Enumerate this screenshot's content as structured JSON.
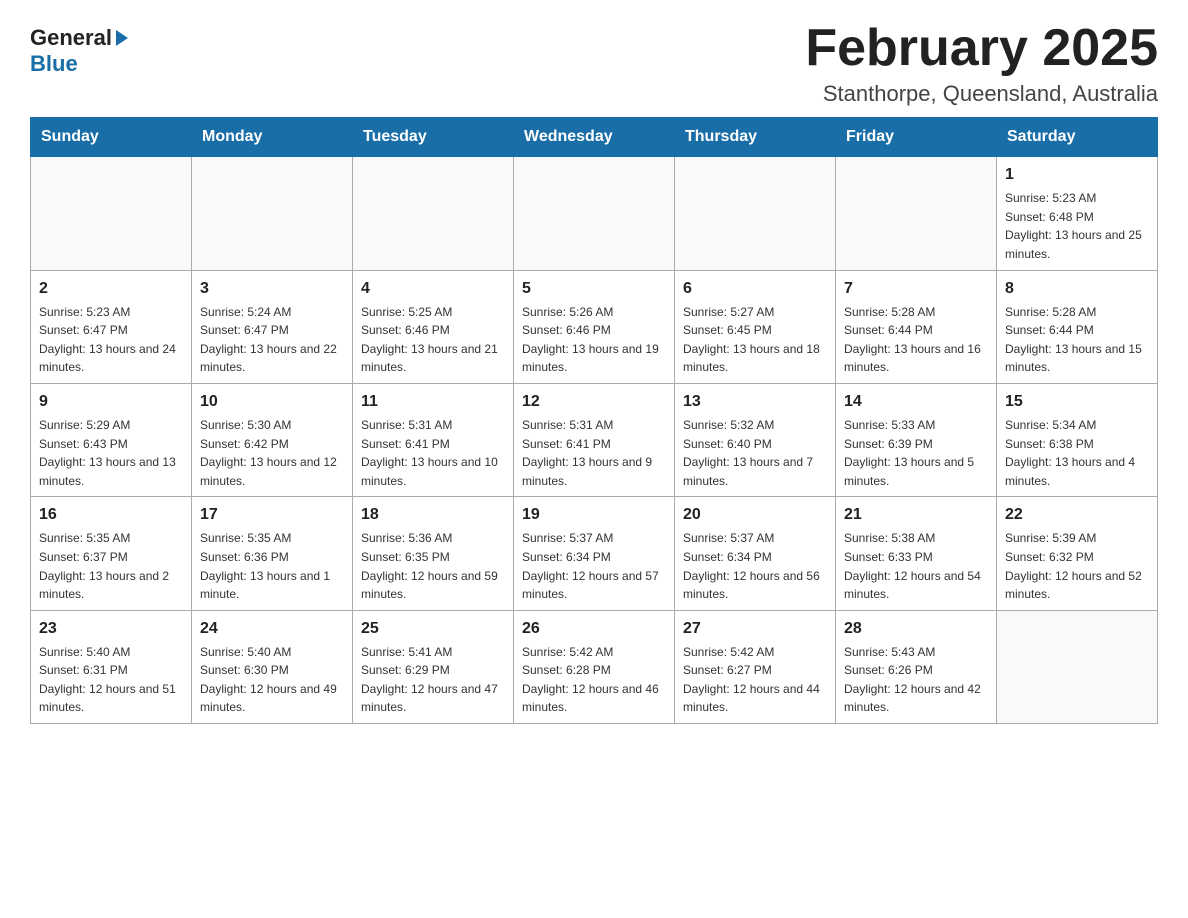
{
  "logo": {
    "general": "General",
    "blue": "Blue"
  },
  "title": "February 2025",
  "subtitle": "Stanthorpe, Queensland, Australia",
  "headers": [
    "Sunday",
    "Monday",
    "Tuesday",
    "Wednesday",
    "Thursday",
    "Friday",
    "Saturday"
  ],
  "weeks": [
    [
      {
        "day": "",
        "info": ""
      },
      {
        "day": "",
        "info": ""
      },
      {
        "day": "",
        "info": ""
      },
      {
        "day": "",
        "info": ""
      },
      {
        "day": "",
        "info": ""
      },
      {
        "day": "",
        "info": ""
      },
      {
        "day": "1",
        "info": "Sunrise: 5:23 AM\nSunset: 6:48 PM\nDaylight: 13 hours and 25 minutes."
      }
    ],
    [
      {
        "day": "2",
        "info": "Sunrise: 5:23 AM\nSunset: 6:47 PM\nDaylight: 13 hours and 24 minutes."
      },
      {
        "day": "3",
        "info": "Sunrise: 5:24 AM\nSunset: 6:47 PM\nDaylight: 13 hours and 22 minutes."
      },
      {
        "day": "4",
        "info": "Sunrise: 5:25 AM\nSunset: 6:46 PM\nDaylight: 13 hours and 21 minutes."
      },
      {
        "day": "5",
        "info": "Sunrise: 5:26 AM\nSunset: 6:46 PM\nDaylight: 13 hours and 19 minutes."
      },
      {
        "day": "6",
        "info": "Sunrise: 5:27 AM\nSunset: 6:45 PM\nDaylight: 13 hours and 18 minutes."
      },
      {
        "day": "7",
        "info": "Sunrise: 5:28 AM\nSunset: 6:44 PM\nDaylight: 13 hours and 16 minutes."
      },
      {
        "day": "8",
        "info": "Sunrise: 5:28 AM\nSunset: 6:44 PM\nDaylight: 13 hours and 15 minutes."
      }
    ],
    [
      {
        "day": "9",
        "info": "Sunrise: 5:29 AM\nSunset: 6:43 PM\nDaylight: 13 hours and 13 minutes."
      },
      {
        "day": "10",
        "info": "Sunrise: 5:30 AM\nSunset: 6:42 PM\nDaylight: 13 hours and 12 minutes."
      },
      {
        "day": "11",
        "info": "Sunrise: 5:31 AM\nSunset: 6:41 PM\nDaylight: 13 hours and 10 minutes."
      },
      {
        "day": "12",
        "info": "Sunrise: 5:31 AM\nSunset: 6:41 PM\nDaylight: 13 hours and 9 minutes."
      },
      {
        "day": "13",
        "info": "Sunrise: 5:32 AM\nSunset: 6:40 PM\nDaylight: 13 hours and 7 minutes."
      },
      {
        "day": "14",
        "info": "Sunrise: 5:33 AM\nSunset: 6:39 PM\nDaylight: 13 hours and 5 minutes."
      },
      {
        "day": "15",
        "info": "Sunrise: 5:34 AM\nSunset: 6:38 PM\nDaylight: 13 hours and 4 minutes."
      }
    ],
    [
      {
        "day": "16",
        "info": "Sunrise: 5:35 AM\nSunset: 6:37 PM\nDaylight: 13 hours and 2 minutes."
      },
      {
        "day": "17",
        "info": "Sunrise: 5:35 AM\nSunset: 6:36 PM\nDaylight: 13 hours and 1 minute."
      },
      {
        "day": "18",
        "info": "Sunrise: 5:36 AM\nSunset: 6:35 PM\nDaylight: 12 hours and 59 minutes."
      },
      {
        "day": "19",
        "info": "Sunrise: 5:37 AM\nSunset: 6:34 PM\nDaylight: 12 hours and 57 minutes."
      },
      {
        "day": "20",
        "info": "Sunrise: 5:37 AM\nSunset: 6:34 PM\nDaylight: 12 hours and 56 minutes."
      },
      {
        "day": "21",
        "info": "Sunrise: 5:38 AM\nSunset: 6:33 PM\nDaylight: 12 hours and 54 minutes."
      },
      {
        "day": "22",
        "info": "Sunrise: 5:39 AM\nSunset: 6:32 PM\nDaylight: 12 hours and 52 minutes."
      }
    ],
    [
      {
        "day": "23",
        "info": "Sunrise: 5:40 AM\nSunset: 6:31 PM\nDaylight: 12 hours and 51 minutes."
      },
      {
        "day": "24",
        "info": "Sunrise: 5:40 AM\nSunset: 6:30 PM\nDaylight: 12 hours and 49 minutes."
      },
      {
        "day": "25",
        "info": "Sunrise: 5:41 AM\nSunset: 6:29 PM\nDaylight: 12 hours and 47 minutes."
      },
      {
        "day": "26",
        "info": "Sunrise: 5:42 AM\nSunset: 6:28 PM\nDaylight: 12 hours and 46 minutes."
      },
      {
        "day": "27",
        "info": "Sunrise: 5:42 AM\nSunset: 6:27 PM\nDaylight: 12 hours and 44 minutes."
      },
      {
        "day": "28",
        "info": "Sunrise: 5:43 AM\nSunset: 6:26 PM\nDaylight: 12 hours and 42 minutes."
      },
      {
        "day": "",
        "info": ""
      }
    ]
  ]
}
